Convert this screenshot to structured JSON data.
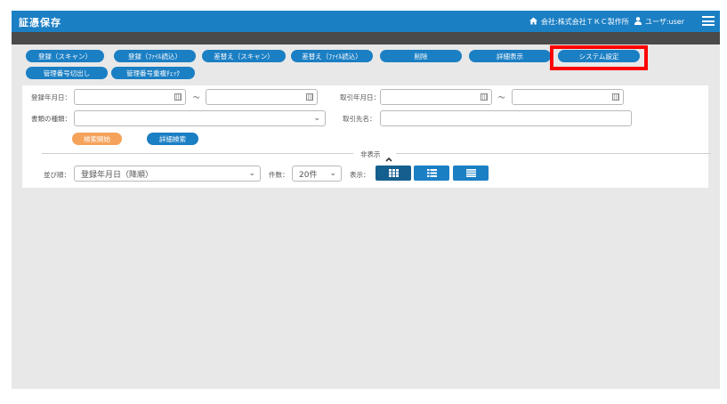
{
  "header": {
    "title": "証憑保存",
    "company": "会社:株式会社ＴＫＣ製作所",
    "user": "ユーザ:user"
  },
  "toolbar": {
    "row1": [
      "登録（スキャン）",
      "登録（ﾌｧｲﾙ読込）",
      "差替え（スキャン）",
      "差替え（ﾌｧｲﾙ読込）",
      "削除",
      "詳細表示",
      "システム設定"
    ],
    "row2": [
      "管理番号切出し",
      "管理番号重複ﾁｪｯｸ"
    ]
  },
  "search": {
    "reg_date_label": "登録年月日：",
    "tx_date_label": "取引年月日：",
    "range_sep": "～",
    "doc_type_label": "書類の種類：",
    "partner_label": "取引先名：",
    "search_button": "検索開始",
    "detail_search_button": "詳細検索",
    "toggle_label": "非表示"
  },
  "sort": {
    "label": "並び順：",
    "value": "登録年月日（降順）",
    "count_label": "件数：",
    "count_value": "20件",
    "display_label": "表示："
  },
  "colors": {
    "brand": "#1b7fc4",
    "search": "#f5a25a",
    "highlight": "#ff0000",
    "view_active": "#155f8f"
  }
}
